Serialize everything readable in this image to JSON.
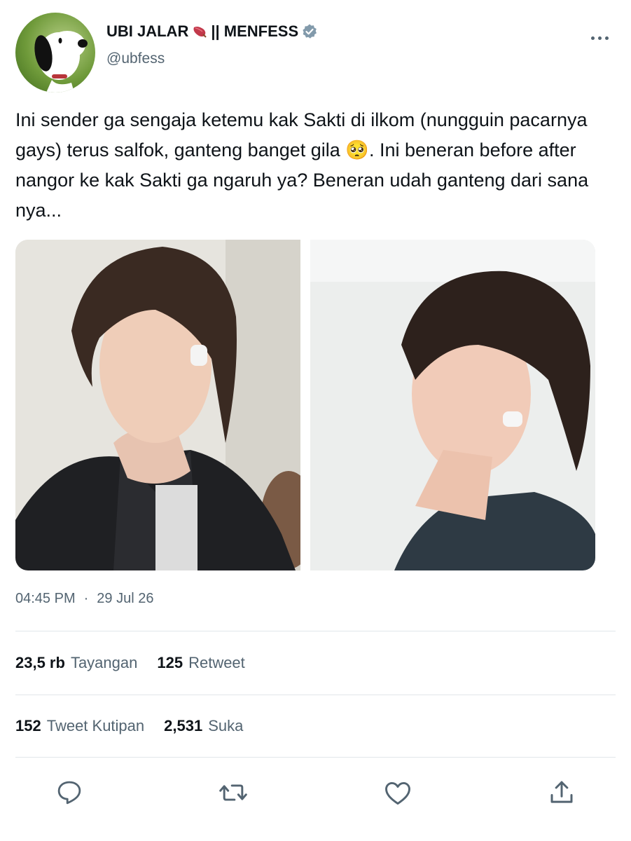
{
  "account": {
    "name": "UBI JALAR",
    "name_suffix": "|| MENFESS",
    "handle": "@ubfess",
    "verified": true,
    "avatar_icon": "snoopy-avatar"
  },
  "tweet": {
    "text_before_emoji": "Ini sender ga sengaja ketemu kak Sakti di ilkom (nungguin pacarnya gays) terus salfok, ganteng banget gila ",
    "emoji": "🥺",
    "text_after_emoji": ". Ini beneran before after nangor ke kak Sakti ga ngaruh ya? Beneran udah ganteng dari sana nya...",
    "time": "04:45 PM",
    "separator": "·",
    "date": "29 Jul 26"
  },
  "stats": {
    "views_count": "23,5 rb",
    "views_label": "Tayangan",
    "retweets_count": "125",
    "retweets_label": "Retweet",
    "quotes_count": "152",
    "quotes_label": "Tweet Kutipan",
    "likes_count": "2,531",
    "likes_label": "Suka"
  },
  "actions": [
    "reply-icon",
    "retweet-icon",
    "like-icon",
    "share-icon"
  ],
  "colors": {
    "text": "#0f1419",
    "secondary": "#536471",
    "verified": "#829aab",
    "divider": "#e1e6ea"
  }
}
